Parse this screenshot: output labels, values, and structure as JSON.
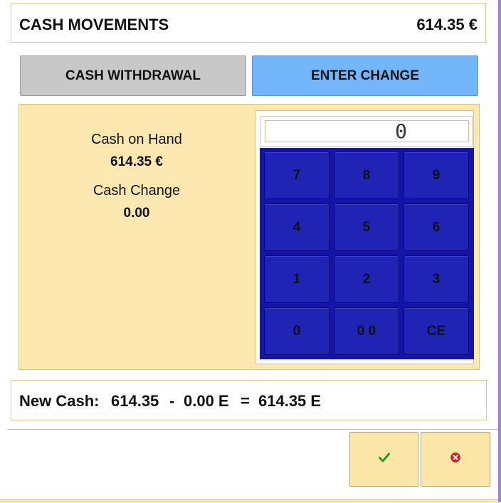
{
  "header": {
    "title": "CASH MOVEMENTS",
    "amount": "614.35 €"
  },
  "modes": {
    "withdrawal": "CASH WITHDRAWAL",
    "change": "ENTER CHANGE"
  },
  "info": {
    "cash_on_hand_label": "Cash on Hand",
    "cash_on_hand_value": "614.35 €",
    "cash_change_label": "Cash Change",
    "cash_change_value": "0.00"
  },
  "keypad": {
    "display_value": "0",
    "keys": [
      "7",
      "8",
      "9",
      "4",
      "5",
      "6",
      "1",
      "2",
      "3",
      "0",
      "0 0",
      "CE"
    ]
  },
  "summary": {
    "label": "New Cash:",
    "base": "614.35",
    "op_minus": "-",
    "change": "0.00 E",
    "op_equals": "=",
    "result": "614.35 E"
  },
  "actions": {
    "confirm_icon": "check-icon",
    "cancel_icon": "cancel-icon"
  },
  "colors": {
    "accent_blue": "#73b6fa",
    "panel_bg": "#fde9b0",
    "keypad_bg": "#1414a8",
    "action_bg": "#fde7a8"
  }
}
